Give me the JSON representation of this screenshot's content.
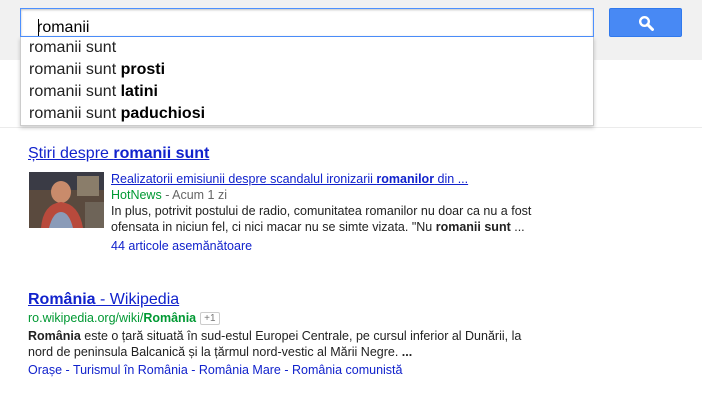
{
  "search": {
    "query": "romanii sunt",
    "suggestions": [
      {
        "prefix": "romanii sunt",
        "completion": ""
      },
      {
        "prefix": "romanii sunt ",
        "completion": "prosti"
      },
      {
        "prefix": "romanii sunt ",
        "completion": "latini"
      },
      {
        "prefix": "romanii sunt ",
        "completion": "paduchiosi"
      }
    ]
  },
  "news": {
    "heading_prefix": "Știri despre ",
    "heading_bold": "romanii sunt",
    "article_title_prefix": "Realizatorii emisiunii despre scandalul ironizarii ",
    "article_title_bold": "romanilor",
    "article_title_suffix": " din ...",
    "source": "HotNews",
    "time": " - Acum 1 zi",
    "snippet_text": "In plus, potrivit postului de radio, comunitatea romanilor nu doar ca nu a fost ofensata in niciun fel, ci nici macar nu se simte vizata. \"Nu ",
    "snippet_bold": "romanii sunt",
    "snippet_end": " ...",
    "related": "44 articole asemănătoare"
  },
  "wiki": {
    "title_bold": "România",
    "title_rest": " - Wikipedia",
    "url_prefix": "ro.wikipedia.org/wiki/",
    "url_bold": "România",
    "plus_one": "+1",
    "snippet_bold": "România",
    "snippet_text": " este o țară situată în sud-estul Europei Centrale, pe cursul inferior al Dunării, la nord de peninsula Balcanică și la țărmul nord-vestic al Mării Negre. ",
    "snippet_end": "...",
    "sitelinks": [
      "Orașe",
      "Turismul în România",
      "România Mare",
      "România comunistă"
    ],
    "sitelink_separator": " - "
  },
  "colors": {
    "link": "#1122cc",
    "url": "#009933",
    "button": "#4889f4"
  },
  "icons": {
    "search_button": "magnifier-icon"
  }
}
